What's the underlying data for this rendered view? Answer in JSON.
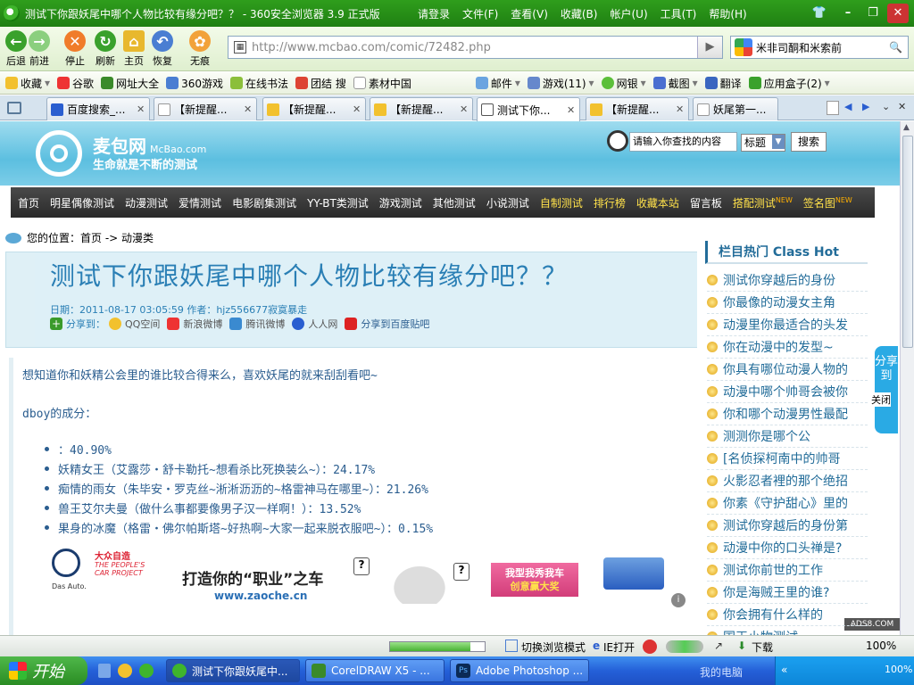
{
  "window": {
    "title": "测试下你跟妖尾中哪个人物比较有缘分吧？？ - 360安全浏览器 3.9 正式版",
    "menus": [
      "请登录",
      "文件(F)",
      "查看(V)",
      "收藏(B)",
      "帐户(U)",
      "工具(T)",
      "帮助(H)"
    ]
  },
  "toolbar": {
    "back": "后退",
    "forward": "前进",
    "stop": "停止",
    "refresh": "刷新",
    "home": "主页",
    "restore": "恢复",
    "incognito": "无痕"
  },
  "address": {
    "url": "http://www.mcbao.com/comic/72482.php"
  },
  "search": {
    "value": "米非司酮和米索前"
  },
  "favorites": [
    "收藏",
    "谷歌",
    "网址大全",
    "360游戏",
    "在线书法",
    "团结 搜",
    "素材中国",
    "邮件",
    "游戏(11)",
    "网银",
    "截图",
    "翻译",
    "应用盒子(2)"
  ],
  "tabs": [
    "百度搜索_...",
    "【新提醒...",
    "【新提醒...",
    "【新提醒...",
    "测试下你...",
    "【新提醒...",
    "妖尾第一..."
  ],
  "site": {
    "brand": "麦包网",
    "brand_en": "McBao.com",
    "slogan": "生命就是不断的测试",
    "search_placeholder": "请输入你查找的内容",
    "search_select": "标题",
    "search_button": "搜索",
    "menu": [
      "首页",
      "明星偶像测试",
      "动漫测试",
      "爱情测试",
      "电影剧集测试",
      "YY-BT类测试",
      "游戏测试",
      "其他测试",
      "小说测试",
      "自制测试",
      "排行榜",
      "收藏本站",
      "留言板",
      "搭配测试",
      "签名图"
    ],
    "menu_new_badge": "NEW",
    "breadcrumb": "您的位置：首页 -> 动漫类"
  },
  "article": {
    "title": "测试下你跟妖尾中哪个人物比较有缘分吧？？",
    "meta": "日期：2011-08-17 03:05:59 作者：hjz556677寂寞暴走",
    "share_label": "分享到：",
    "share_targets": [
      "QQ空间",
      "新浪微博",
      "腾讯微博",
      "人人网",
      "分享到百度贴吧"
    ],
    "intro": "想知道你和妖精公会里的谁比较合得来么，喜欢妖尾的就来刮刮看吧~",
    "subject": "dboy的成分：",
    "results": [
      "：40.90%",
      "妖精女王（艾露莎・舒卡勒托~想看杀比死换装么~）：24.17%",
      "痴情的雨女（朱毕安・罗克丝~淅淅沥沥的~格雷神马在哪里~）：21.26%",
      "兽王艾尔夫曼（做什么事都要像男子汉一样啊！）：13.52%",
      "果身的冰魔（格雷・佛尔帕斯塔~好热啊~大家一起来脱衣服吧~）：0.15%"
    ]
  },
  "ad": {
    "brand": "Das Auto.",
    "campaign_top": "大众自造",
    "campaign_en": "THE PEOPLE'S CAR PROJECT",
    "headline": "打造你的“职业”之车",
    "url": "www.zaoche.cn",
    "cta_line1": "我型我秀我车",
    "cta_line2": "创意赢大奖",
    "ad_badge": "ADS8.COM"
  },
  "sidebar": {
    "heading": "栏目热门 Class Hot",
    "items": [
      "测试你穿越后的身份",
      "你最像的动漫女主角",
      "动漫里你最适合的头发",
      "你在动漫中的发型~",
      "你具有哪位动漫人物的",
      "动漫中哪个帅哥会被你",
      "你和哪个动漫男性最配",
      "测测你是哪个公",
      "[名侦探柯南中的帅哥",
      "火影忍者裡的那个绝招",
      "你素《守护甜心》里的",
      "测试你穿越后的身份第",
      "动漫中你的口头禅是?",
      "测试你前世的工作",
      "你是海贼王里的谁?",
      "你会拥有什么样的",
      "国王小物测试"
    ]
  },
  "share_float": {
    "label": "分享到",
    "close": "关闭"
  },
  "statusbar": {
    "switch_mode": "切换浏览模式",
    "ie_open": "IE打开",
    "download": "下载",
    "zoom": "100%",
    "progress": 0.85
  },
  "taskbar": {
    "start": "开始",
    "tasks": [
      "测试下你跟妖尾中...",
      "CorelDRAW X5 - ...",
      "Adobe Photoshop ..."
    ],
    "tray_text": "我的电脑",
    "tray_zoom": "100%"
  }
}
